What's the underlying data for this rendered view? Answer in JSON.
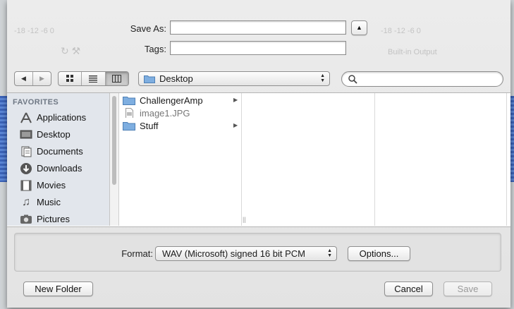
{
  "dialog": {
    "save_as_label": "Save As:",
    "save_as_value": "",
    "tags_label": "Tags:",
    "tags_value": ""
  },
  "toolbar": {
    "location": "Desktop",
    "search_placeholder": ""
  },
  "sidebar": {
    "heading": "FAVORITES",
    "items": [
      {
        "label": "Applications",
        "icon": "applications-icon"
      },
      {
        "label": "Desktop",
        "icon": "desktop-icon"
      },
      {
        "label": "Documents",
        "icon": "documents-icon"
      },
      {
        "label": "Downloads",
        "icon": "downloads-icon"
      },
      {
        "label": "Movies",
        "icon": "movies-icon"
      },
      {
        "label": "Music",
        "icon": "music-icon"
      },
      {
        "label": "Pictures",
        "icon": "pictures-icon"
      }
    ]
  },
  "files": [
    {
      "name": "ChallengerAmp",
      "type": "folder"
    },
    {
      "name": "image1.JPG",
      "type": "file"
    },
    {
      "name": "Stuff",
      "type": "folder"
    }
  ],
  "format": {
    "label": "Format:",
    "selected": "WAV (Microsoft) signed 16 bit PCM",
    "options_button": "Options..."
  },
  "footer": {
    "new_folder": "New Folder",
    "cancel": "Cancel",
    "save": "Save"
  },
  "background": {
    "output_label": "Built-in Output"
  },
  "colors": {
    "folder": "#6a9fd6",
    "sidebar_bg": "#e2e6ec",
    "waveform": "#3b63b8"
  }
}
